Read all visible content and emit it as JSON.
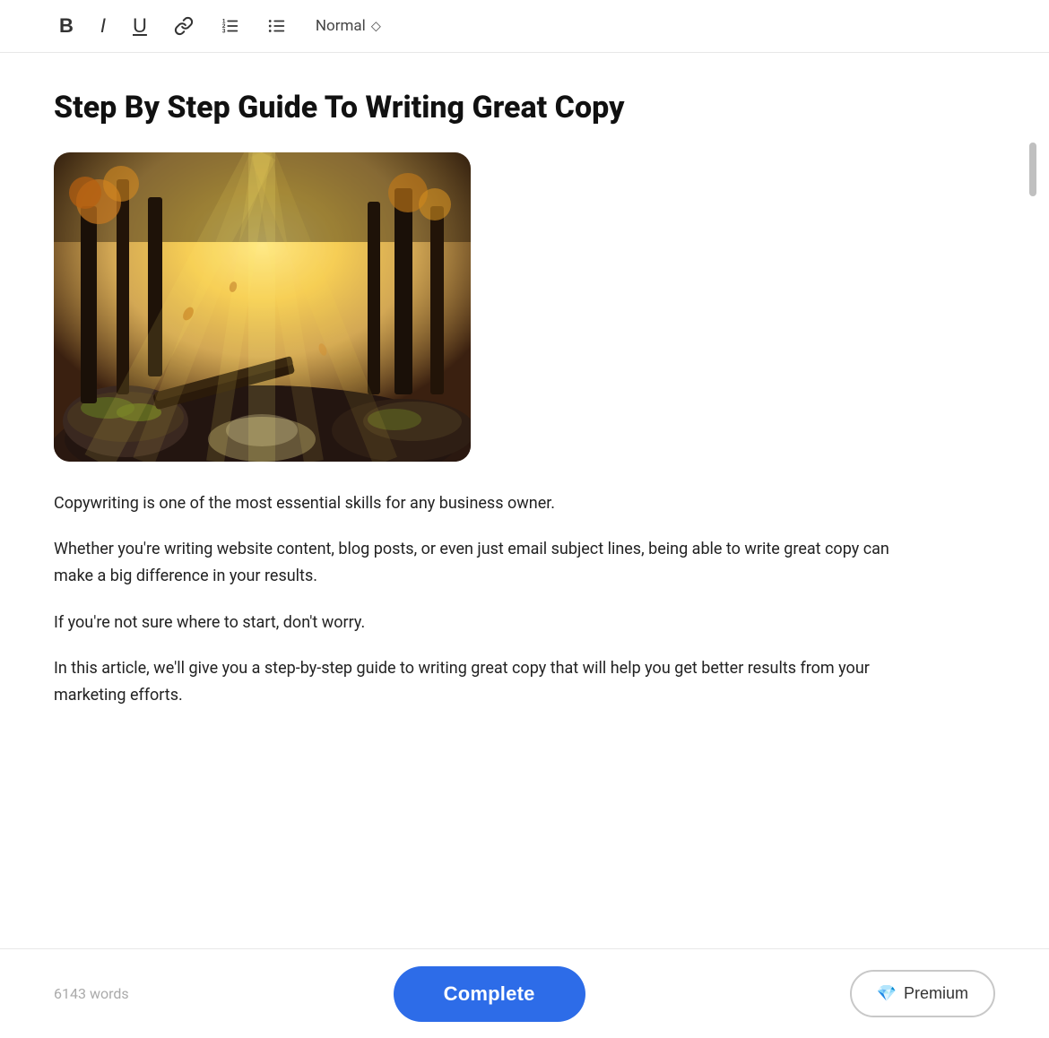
{
  "toolbar": {
    "bold_label": "B",
    "italic_label": "I",
    "underline_label": "U",
    "link_icon": "🔗",
    "ordered_list_icon": "☰",
    "unordered_list_icon": "≡",
    "font_style": "Normal",
    "select_arrow": "⬡"
  },
  "document": {
    "title": "Step By Step Guide To Writing Great Copy",
    "image_alt": "Forest scene with sunlight",
    "paragraphs": [
      "Copywriting is one of the most essential skills for any business owner.",
      "Whether you're writing website content, blog posts, or even just email subject lines, being able to write great copy can make a big difference in your results.",
      "If you're not sure where to start, don't worry.",
      "In this article, we'll give you a step-by-step guide to writing great copy that will help you get better results from your marketing efforts."
    ]
  },
  "bottom_bar": {
    "word_count": "6143 words",
    "complete_label": "Complete",
    "premium_label": "Premium",
    "diamond_icon": "💎"
  }
}
